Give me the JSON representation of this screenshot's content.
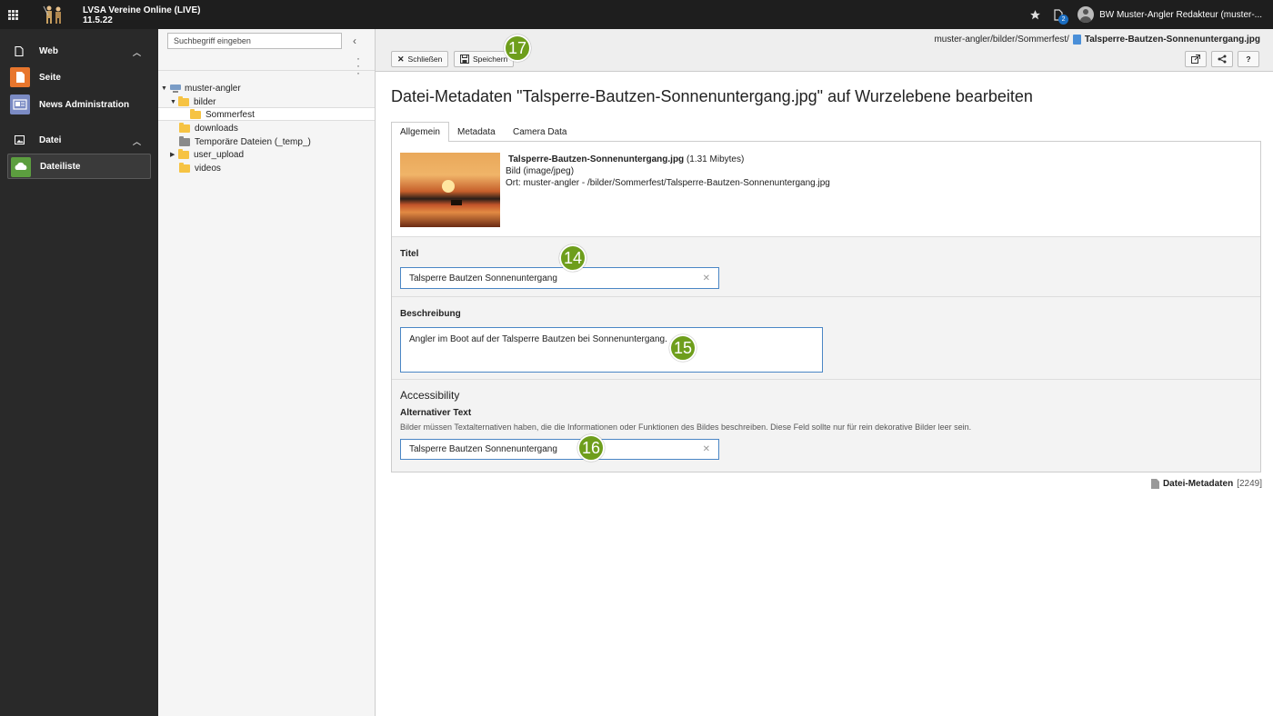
{
  "app": {
    "name": "LVSA Vereine Online (LIVE)",
    "version": "11.5.22"
  },
  "topbar": {
    "notification_count": "2",
    "user_label": "BW Muster-Angler Redakteur (muster-..."
  },
  "nav": {
    "web_group": "Web",
    "seite": "Seite",
    "news": "News Administration",
    "datei_group": "Datei",
    "dateiliste": "Dateiliste"
  },
  "tree": {
    "search_placeholder": "Suchbegriff eingeben",
    "root": "muster-angler",
    "bilder": "bilder",
    "sommerfest": "Sommerfest",
    "downloads": "downloads",
    "temp": "Temporäre Dateien (_temp_)",
    "user_upload": "user_upload",
    "videos": "videos"
  },
  "toolbar": {
    "close_label": "Schließen",
    "save_label": "Speichern"
  },
  "breadcrumb": {
    "path": "muster-angler/bilder/Sommerfest/",
    "file": "Talsperre-Bautzen-Sonnenuntergang.jpg"
  },
  "page": {
    "title": "Datei-Metadaten \"Talsperre-Bautzen-Sonnenuntergang.jpg\" auf Wurzelebene bearbeiten"
  },
  "tabs": [
    "Allgemein",
    "Metadata",
    "Camera Data"
  ],
  "file": {
    "name": "Talsperre-Bautzen-Sonnenuntergang.jpg",
    "size": "(1.31 Mibytes)",
    "type": "Bild (image/jpeg)",
    "location": "Ort: muster-angler - /bilder/Sommerfest/Talsperre-Bautzen-Sonnenuntergang.jpg"
  },
  "form": {
    "title_label": "Titel",
    "title_value": "Talsperre Bautzen Sonnenuntergang",
    "desc_label": "Beschreibung",
    "desc_value": "Angler im Boot auf der Talsperre Bautzen bei Sonnenuntergang.",
    "access_heading": "Accessibility",
    "alt_label": "Alternativer Text",
    "alt_help": "Bilder müssen Textalternativen haben, die die Informationen oder Funktionen des Bildes beschreiben. Diese Feld sollte nur für rein dekorative Bilder leer sein.",
    "alt_value": "Talsperre Bautzen Sonnenuntergang"
  },
  "footer": {
    "record_label": "Datei-Metadaten",
    "record_id": "[2249]"
  },
  "markers": {
    "m14": "14",
    "m15": "15",
    "m16": "16",
    "m17": "17"
  },
  "colors": {
    "accent": "#6e9e1c",
    "topbar": "#1e1e1e",
    "sidebar": "#292929",
    "field_border": "#4a86c5"
  }
}
